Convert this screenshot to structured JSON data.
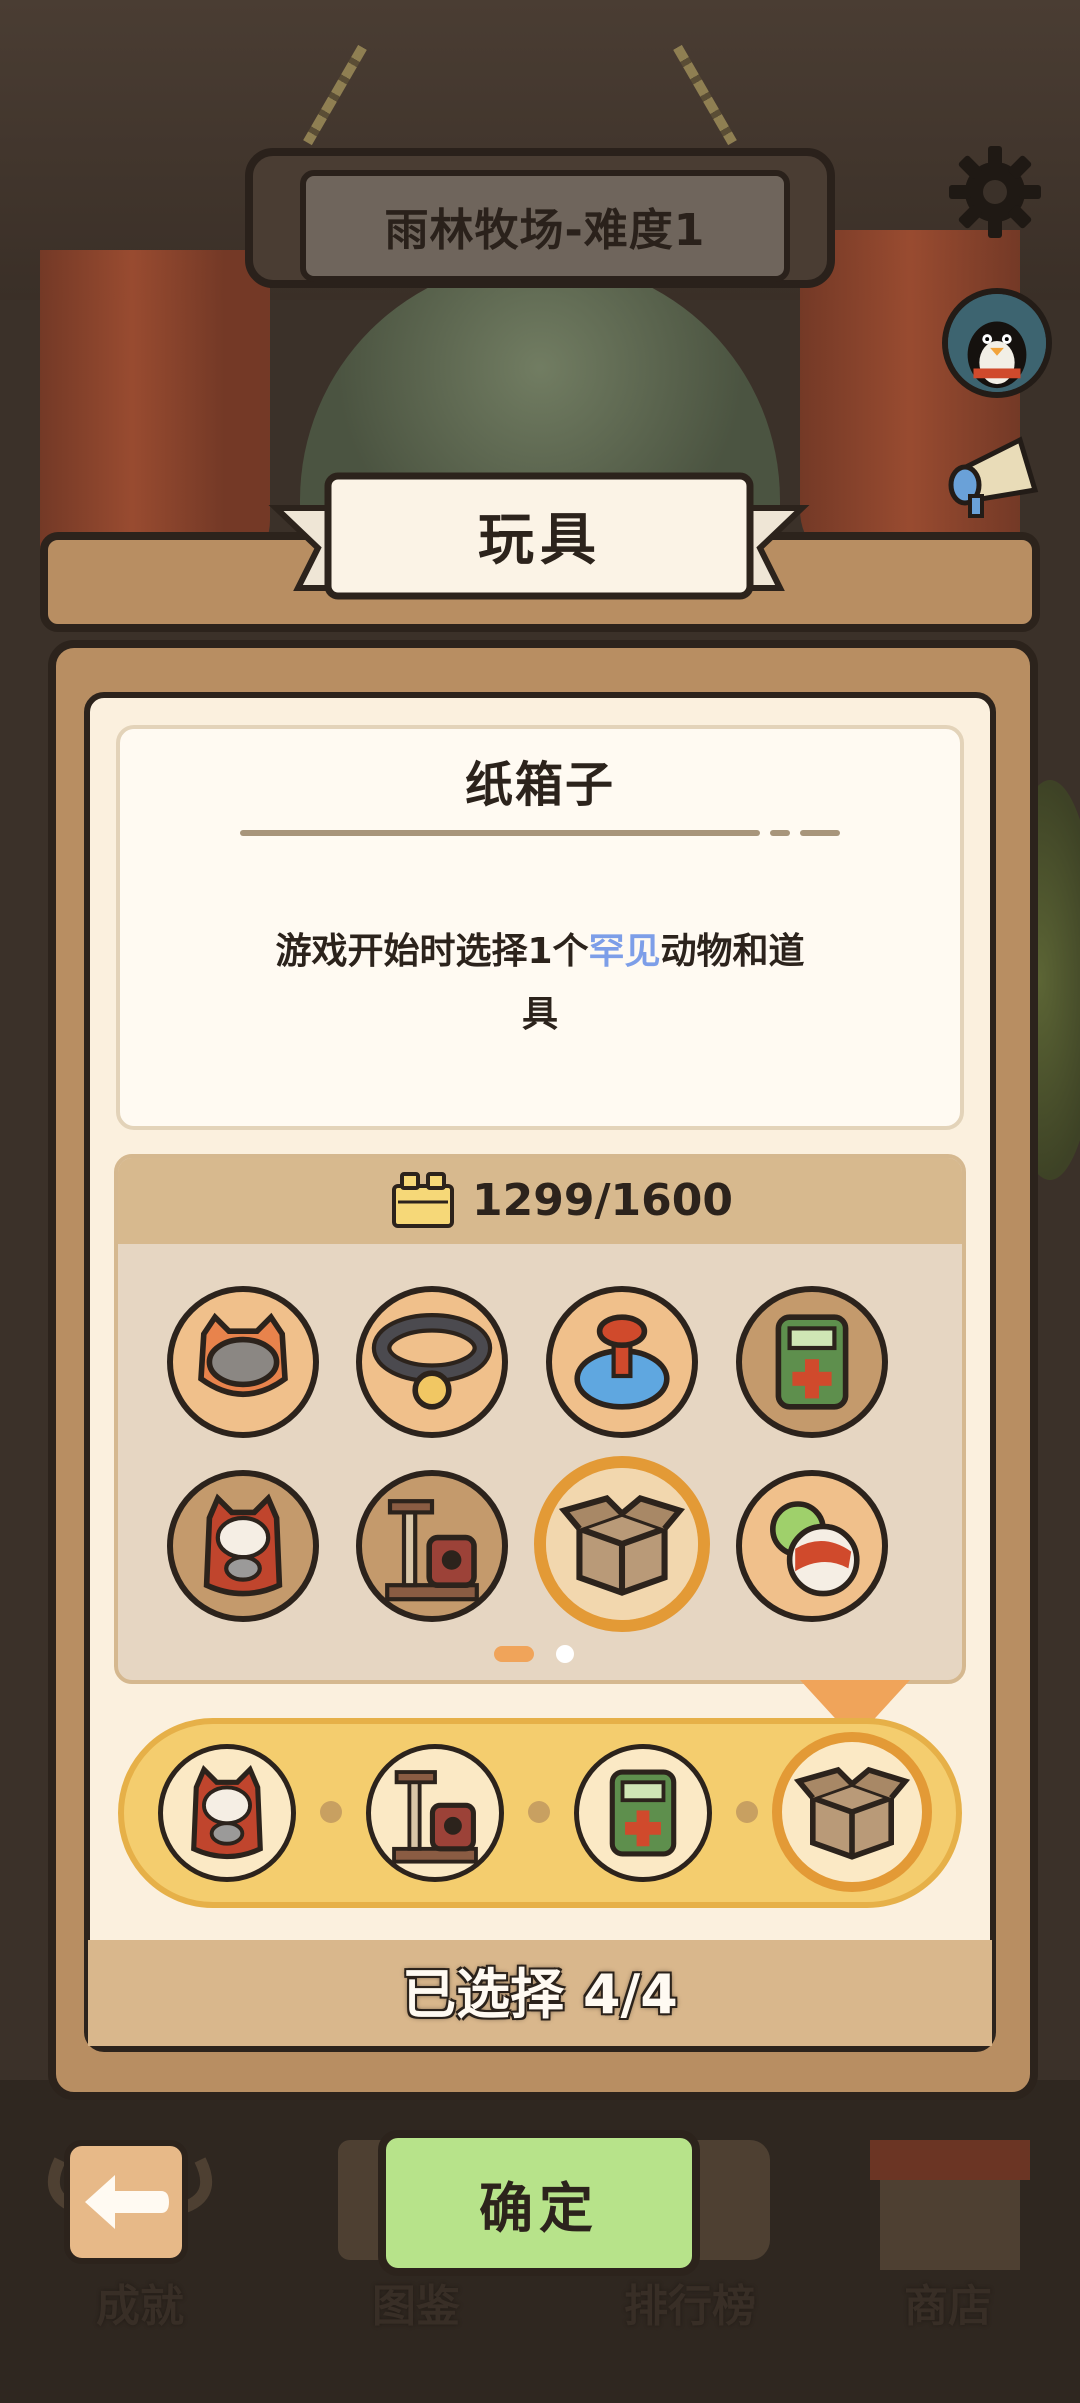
{
  "header": {
    "level_title": "雨林牧场-难度1"
  },
  "panel": {
    "title": "玩具",
    "item_name": "纸箱子",
    "description_prefix": "游戏开始时选择1个",
    "description_highlight": "罕见",
    "description_suffix": "动物和道",
    "description_line2": "具",
    "cost": "1299/1600",
    "selected_text": "已选择 4/4",
    "confirm_label": "确定"
  },
  "toy_grid": [
    {
      "name": "ceramic bowl",
      "icon": "bowl-icon"
    },
    {
      "name": "collar",
      "icon": "collar-icon"
    },
    {
      "name": "spinning top",
      "icon": "spinner-icon"
    },
    {
      "name": "game console",
      "icon": "console-icon"
    },
    {
      "name": "cat doll",
      "icon": "cat-doll-icon"
    },
    {
      "name": "scratch tower",
      "icon": "cat-tree-icon"
    },
    {
      "name": "cardboard box",
      "icon": "box-icon",
      "selected": true
    },
    {
      "name": "beach ball",
      "icon": "ball-icon"
    }
  ],
  "selected_toys": [
    {
      "icon": "cat-doll-icon"
    },
    {
      "icon": "cat-tree-icon"
    },
    {
      "icon": "console-icon"
    },
    {
      "icon": "box-icon"
    }
  ],
  "pagination": {
    "pages": 2,
    "current": 1
  },
  "bottom_nav": [
    {
      "label": "成就"
    },
    {
      "label": "图鉴"
    },
    {
      "label": "排行榜"
    },
    {
      "label": "商店"
    }
  ],
  "colors": {
    "accent_orange": "#e39a36",
    "rare_blue": "#7d9ee8",
    "confirm_green": "#b7e38a",
    "panel_wood": "#b88e62"
  }
}
